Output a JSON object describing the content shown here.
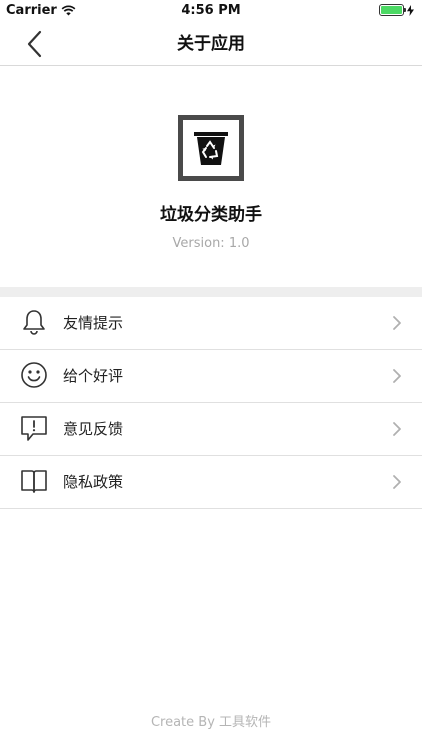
{
  "status_bar": {
    "carrier": "Carrier",
    "time": "4:56 PM",
    "wifi_icon": "wifi-icon",
    "battery_icon": "battery-icon",
    "charging_icon": "bolt-icon",
    "battery_level": 1.0
  },
  "nav": {
    "title": "关于应用",
    "back_icon": "chevron-left-icon"
  },
  "app": {
    "name": "垃圾分类助手",
    "version": "Version: 1.0",
    "icon": "recycle-bin-icon"
  },
  "menu": {
    "items": [
      {
        "label": "友情提示",
        "icon": "bell-icon"
      },
      {
        "label": "给个好评",
        "icon": "smiley-icon"
      },
      {
        "label": "意见反馈",
        "icon": "feedback-bubble-icon"
      },
      {
        "label": "隐私政策",
        "icon": "book-icon"
      }
    ],
    "chevron_icon": "chevron-right-icon"
  },
  "footer": {
    "text": "Create By 工具软件"
  },
  "colors": {
    "divider": "#d9d9d9",
    "section_gap": "#eeeeee",
    "version_text": "#a8a8a8",
    "footer_text": "#b5b5b5",
    "battery": "#4cd964"
  }
}
